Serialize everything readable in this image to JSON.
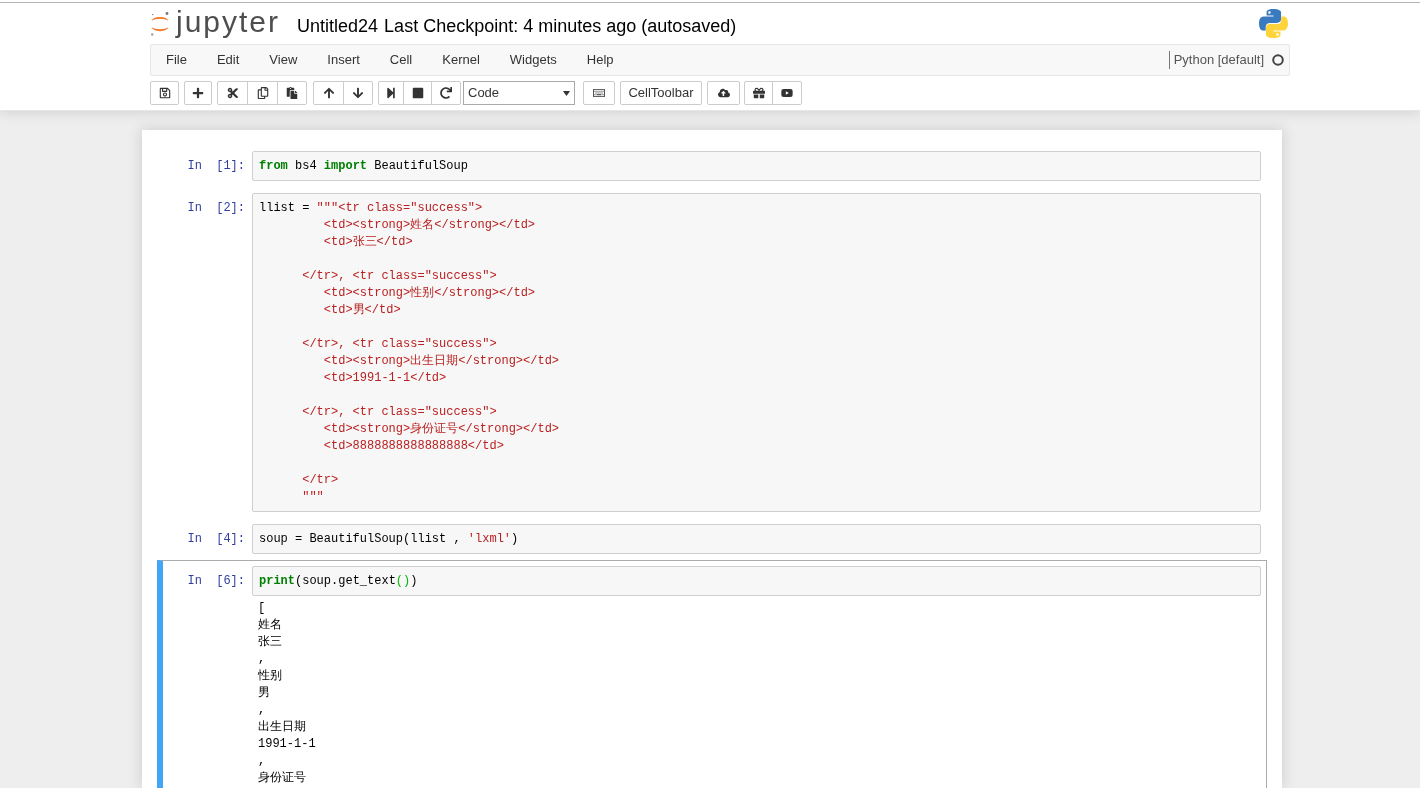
{
  "header": {
    "logo_text": "jupyter",
    "notebook_name": "Untitled24",
    "checkpoint": "Last Checkpoint: 4 minutes ago (autosaved)"
  },
  "menu": [
    "File",
    "Edit",
    "View",
    "Insert",
    "Cell",
    "Kernel",
    "Widgets",
    "Help"
  ],
  "kernel": {
    "name": "Python [default]",
    "busy": false
  },
  "toolbar": {
    "cell_type": "Code",
    "cell_toolbar_button": "CellToolbar"
  },
  "cells": [
    {
      "prompt": "In [1]:",
      "selected": false,
      "source": [
        {
          "kind": "keyword",
          "text": "from"
        },
        {
          "kind": "plain",
          "text": " bs4 "
        },
        {
          "kind": "keyword",
          "text": "import"
        },
        {
          "kind": "plain",
          "text": " BeautifulSoup"
        }
      ]
    },
    {
      "prompt": "In [2]:",
      "selected": false,
      "source": [
        {
          "kind": "plain",
          "text": "llist = "
        },
        {
          "kind": "string",
          "text": "\"\"\"<tr class=\"success\">\n         <td><strong>姓名</strong></td>\n         <td>张三</td>\n\n      </tr>, <tr class=\"success\">\n         <td><strong>性别</strong></td>\n         <td>男</td>\n\n      </tr>, <tr class=\"success\">\n         <td><strong>出生日期</strong></td>\n         <td>1991-1-1</td>\n\n      </tr>, <tr class=\"success\">\n         <td><strong>身份证号</strong></td>\n         <td>8888888888888888</td>\n\n      </tr>\n      \"\"\""
        }
      ]
    },
    {
      "prompt": "In [4]:",
      "selected": false,
      "source": [
        {
          "kind": "plain",
          "text": "soup = BeautifulSoup(llist , "
        },
        {
          "kind": "string",
          "text": "'lxml'"
        },
        {
          "kind": "plain",
          "text": ")"
        }
      ]
    },
    {
      "prompt": "In [6]:",
      "selected": true,
      "source": [
        {
          "kind": "keyword",
          "text": "print"
        },
        {
          "kind": "plain",
          "text": "(soup.get_text"
        },
        {
          "kind": "matched_bracket",
          "text": "()"
        },
        {
          "kind": "plain",
          "text": ")"
        }
      ],
      "output": [
        "[",
        "姓名",
        "张三",
        ",",
        "性别",
        "男",
        ",",
        "出生日期",
        "1991-1-1",
        ",",
        "身份证号"
      ]
    }
  ]
}
